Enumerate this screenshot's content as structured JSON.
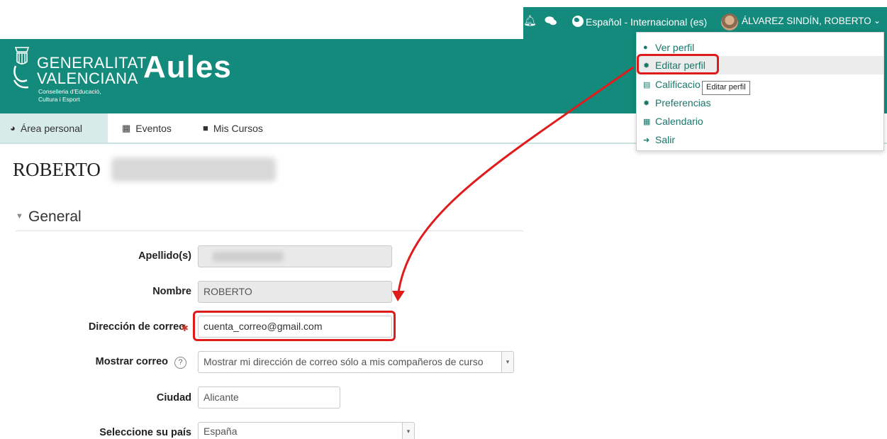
{
  "topbar": {
    "bell_icon": "bell-icon",
    "chat_icon": "comments-icon",
    "language_label": "Español - Internacional (es)",
    "user_name": "ÁLVAREZ SINDÍN, ROBERTO"
  },
  "header": {
    "gv_line1": "GENERALITAT",
    "gv_line2": "VALENCIANA",
    "gv_sub1": "Conselleria d'Educació,",
    "gv_sub2": "Cultura i Esport",
    "app_name": "Aules"
  },
  "nav": {
    "area_personal": "Área personal",
    "eventos": "Eventos",
    "mis_cursos": "Mis Cursos"
  },
  "page": {
    "title": "ROBERTO",
    "section": "General"
  },
  "form": {
    "apellido_label": "Apellido(s)",
    "nombre_label": "Nombre",
    "nombre_value": "ROBERTO",
    "email_label": "Dirección de correo",
    "email_value": "cuenta_correo@gmail.com",
    "mostrar_label": "Mostrar correo",
    "mostrar_value": "Mostrar mi dirección de correo sólo a mis compañeros de curso",
    "ciudad_label": "Ciudad",
    "ciudad_value": "Alicante",
    "pais_label": "Seleccione su país",
    "pais_value": "España"
  },
  "user_menu": {
    "ver_perfil": "Ver perfil",
    "editar_perfil": "Editar perfil",
    "calificaciones": "Calificacio",
    "preferencias": "Preferencias",
    "calendario": "Calendario",
    "salir": "Salir"
  },
  "tooltip": "Editar perfil",
  "colors": {
    "brand": "#138a7b",
    "link": "#17786a",
    "highlight": "#e01b1b"
  }
}
